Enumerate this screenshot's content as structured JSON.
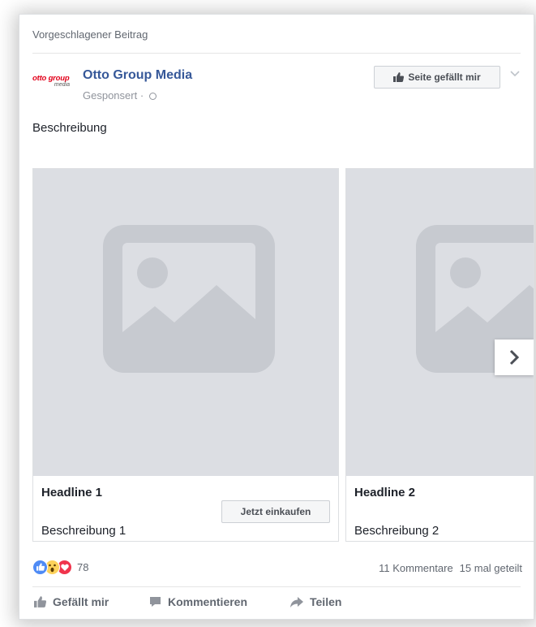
{
  "post": {
    "suggested_label": "Vorgeschlagener Beitrag",
    "page_name": "Otto Group Media",
    "sponsored_label": "Gesponsert ·",
    "logo_text_main": "otto group",
    "logo_text_sub": "media",
    "like_page_label": "Seite gefällt mir",
    "description": "Beschreibung"
  },
  "carousel": {
    "cards": [
      {
        "headline": "Headline 1",
        "description": "Beschreibung 1",
        "cta_label": "Jetzt einkaufen"
      },
      {
        "headline": "Headline 2",
        "description": "Beschreibung 2"
      }
    ],
    "placeholder_icon": "image-placeholder-icon",
    "next_icon": "chevron-right-icon"
  },
  "engagement": {
    "reaction_icons": [
      "like-reaction-icon",
      "wow-reaction-icon",
      "love-reaction-icon"
    ],
    "reaction_count": "78",
    "comments_label": "11 Kommentare",
    "shares_label": "15 mal geteilt"
  },
  "actions": {
    "like_label": "Gefällt mir",
    "comment_label": "Kommentieren",
    "share_label": "Teilen"
  },
  "colors": {
    "link_blue": "#365899",
    "brand_red": "#e2001a",
    "placeholder_bg": "#dcdee3",
    "placeholder_icon": "#c7cad0"
  }
}
